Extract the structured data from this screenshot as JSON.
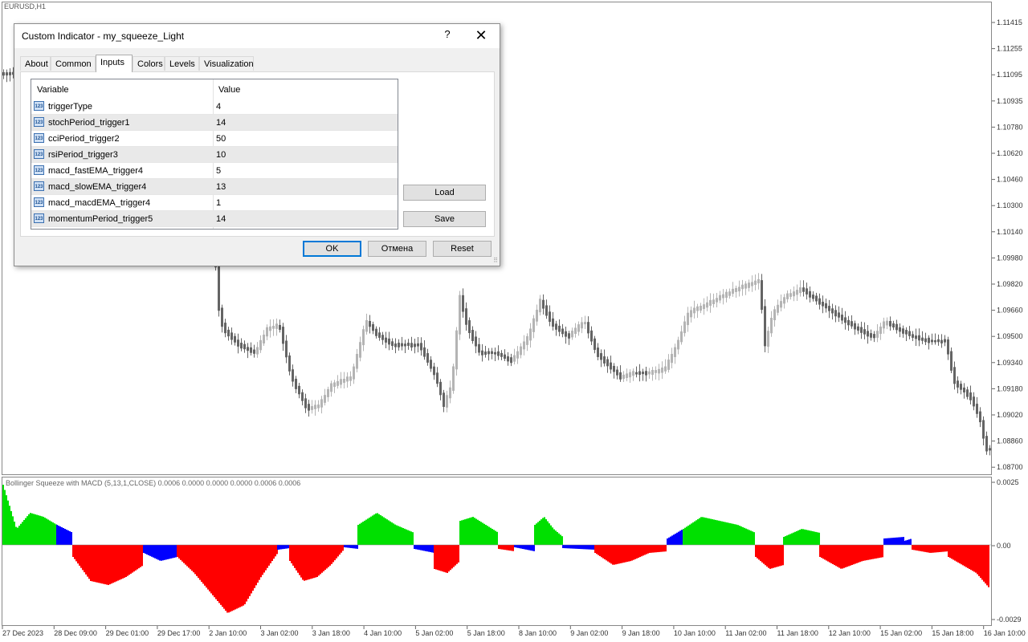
{
  "chart": {
    "symbol": "EURUSD,H1",
    "price_labels": [
      "1.11415",
      "1.11255",
      "1.11095",
      "1.10935",
      "1.10780",
      "1.10620",
      "1.10460",
      "1.10300",
      "1.10140",
      "1.09980",
      "1.09820",
      "1.09660",
      "1.09500",
      "1.09340",
      "1.09180",
      "1.09020",
      "1.08860",
      "1.08700"
    ],
    "indicator_labels": [
      "0.0025",
      "0.00",
      "-0.0029"
    ],
    "time_labels": [
      "27 Dec 2023",
      "28 Dec 09:00",
      "29 Dec 01:00",
      "29 Dec 17:00",
      "2 Jan 10:00",
      "3 Jan 02:00",
      "3 Jan 18:00",
      "4 Jan 10:00",
      "5 Jan 02:00",
      "5 Jan 18:00",
      "8 Jan 10:00",
      "9 Jan 02:00",
      "9 Jan 18:00",
      "10 Jan 10:00",
      "11 Jan 02:00",
      "11 Jan 18:00",
      "12 Jan 10:00",
      "15 Jan 02:00",
      "15 Jan 18:00",
      "16 Jan 10:00"
    ],
    "indicator_title": "Bollinger Squeeze with MACD (5,13,1,CLOSE) 0.0006 0.0000 0.0000 0.0000 0.0006 0.0006",
    "colors": {
      "bull": "#b4b4b4",
      "bear": "#646464",
      "hist_up": "#00e000",
      "hist_down": "#ff0000",
      "hist_neutral": "#0000ff"
    }
  },
  "dialog": {
    "title": "Custom Indicator - my_squeeze_Light",
    "help": "?",
    "close": "✕",
    "tabs": [
      "About",
      "Common",
      "Inputs",
      "Colors",
      "Levels",
      "Visualization"
    ],
    "active_tab": "Inputs",
    "grid_headers": {
      "variable": "Variable",
      "value": "Value"
    },
    "rows": [
      {
        "variable": "triggerType",
        "value": "4"
      },
      {
        "variable": "stochPeriod_trigger1",
        "value": "14"
      },
      {
        "variable": "cciPeriod_trigger2",
        "value": "50"
      },
      {
        "variable": "rsiPeriod_trigger3",
        "value": "10"
      },
      {
        "variable": "macd_fastEMA_trigger4",
        "value": "5"
      },
      {
        "variable": "macd_slowEMA_trigger4",
        "value": "13"
      },
      {
        "variable": "macd_macdEMA_trigger4",
        "value": "1"
      },
      {
        "variable": "momentumPeriod_trigger5",
        "value": "14"
      }
    ],
    "row_icon": "123",
    "buttons": {
      "load": "Load",
      "save": "Save",
      "ok": "OK",
      "cancel": "Отмена",
      "reset": "Reset"
    }
  }
}
